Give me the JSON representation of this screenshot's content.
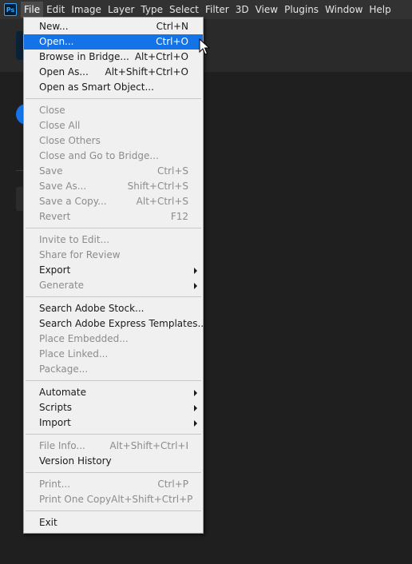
{
  "app": {
    "logo_text": "Ps"
  },
  "menubar": {
    "items": [
      "File",
      "Edit",
      "Image",
      "Layer",
      "Type",
      "Select",
      "Filter",
      "3D",
      "View",
      "Plugins",
      "Window",
      "Help"
    ],
    "active": "File"
  },
  "file_menu": {
    "groups": [
      [
        {
          "label": "New...",
          "shortcut": "Ctrl+N",
          "enabled": true
        },
        {
          "label": "Open...",
          "shortcut": "Ctrl+O",
          "enabled": true,
          "highlighted": true
        },
        {
          "label": "Browse in Bridge...",
          "shortcut": "Alt+Ctrl+O",
          "enabled": true
        },
        {
          "label": "Open As...",
          "shortcut": "Alt+Shift+Ctrl+O",
          "enabled": true
        },
        {
          "label": "Open as Smart Object...",
          "shortcut": "",
          "enabled": true
        }
      ],
      [
        {
          "label": "Close",
          "shortcut": "",
          "enabled": false
        },
        {
          "label": "Close All",
          "shortcut": "",
          "enabled": false
        },
        {
          "label": "Close Others",
          "shortcut": "",
          "enabled": false
        },
        {
          "label": "Close and Go to Bridge...",
          "shortcut": "",
          "enabled": false
        },
        {
          "label": "Save",
          "shortcut": "Ctrl+S",
          "enabled": false
        },
        {
          "label": "Save As...",
          "shortcut": "Shift+Ctrl+S",
          "enabled": false
        },
        {
          "label": "Save a Copy...",
          "shortcut": "Alt+Ctrl+S",
          "enabled": false
        },
        {
          "label": "Revert",
          "shortcut": "F12",
          "enabled": false
        }
      ],
      [
        {
          "label": "Invite to Edit...",
          "shortcut": "",
          "enabled": false
        },
        {
          "label": "Share for Review",
          "shortcut": "",
          "enabled": false
        },
        {
          "label": "Export",
          "shortcut": "",
          "enabled": true,
          "submenu": true
        },
        {
          "label": "Generate",
          "shortcut": "",
          "enabled": false,
          "submenu": true
        }
      ],
      [
        {
          "label": "Search Adobe Stock...",
          "shortcut": "",
          "enabled": true
        },
        {
          "label": "Search Adobe Express Templates...",
          "shortcut": "",
          "enabled": true
        },
        {
          "label": "Place Embedded...",
          "shortcut": "",
          "enabled": false
        },
        {
          "label": "Place Linked...",
          "shortcut": "",
          "enabled": false
        },
        {
          "label": "Package...",
          "shortcut": "",
          "enabled": false
        }
      ],
      [
        {
          "label": "Automate",
          "shortcut": "",
          "enabled": true,
          "submenu": true
        },
        {
          "label": "Scripts",
          "shortcut": "",
          "enabled": true,
          "submenu": true
        },
        {
          "label": "Import",
          "shortcut": "",
          "enabled": true,
          "submenu": true
        }
      ],
      [
        {
          "label": "File Info...",
          "shortcut": "Alt+Shift+Ctrl+I",
          "enabled": false
        },
        {
          "label": "Version History",
          "shortcut": "",
          "enabled": true
        }
      ],
      [
        {
          "label": "Print...",
          "shortcut": "Ctrl+P",
          "enabled": false
        },
        {
          "label": "Print One Copy",
          "shortcut": "Alt+Shift+Ctrl+P",
          "enabled": false
        }
      ],
      [
        {
          "label": "Exit",
          "shortcut": "",
          "enabled": true
        }
      ]
    ]
  },
  "colors": {
    "highlight": "#1473e6",
    "menubar_bg": "#323232",
    "menu_bg": "#f0f0f0",
    "disabled_text": "#8c8c8c"
  }
}
